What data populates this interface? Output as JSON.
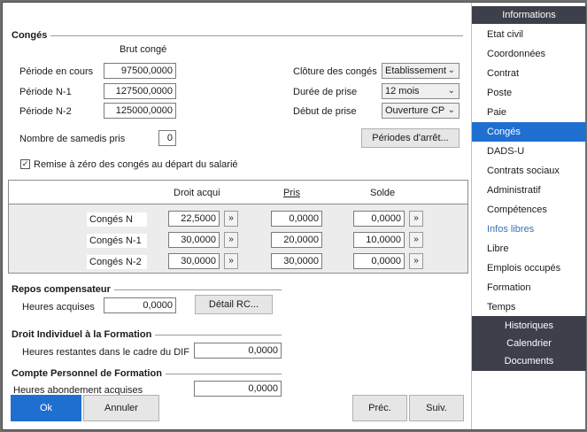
{
  "conges": {
    "title": "Congés",
    "brut_header": "Brut congé",
    "periode_en_cours_label": "Période en cours",
    "periode_en_cours_value": "97500,0000",
    "periode_n1_label": "Période N-1",
    "periode_n1_value": "127500,0000",
    "periode_n2_label": "Période N-2",
    "periode_n2_value": "125000,0000",
    "cloture_label": "Clôture des congés",
    "cloture_value": "Etablissement",
    "duree_label": "Durée de prise",
    "duree_value": "12 mois",
    "debut_label": "Début de prise",
    "debut_value": "Ouverture CP",
    "samedis_label": "Nombre de samedis pris",
    "samedis_value": "0",
    "periodes_arret_button": "Périodes d'arrêt...",
    "remise_checkbox_label": "Remise à zéro des congés au départ du salarié",
    "remise_checked": true
  },
  "grid": {
    "headers": {
      "droit_acquis": "Droit acqui",
      "pris": "Pris",
      "solde": "Solde"
    },
    "arrow": "»",
    "rows": [
      {
        "label": "Congés N",
        "droit": "22,5000",
        "pris": "0,0000",
        "solde": "0,0000"
      },
      {
        "label": "Congés N-1",
        "droit": "30,0000",
        "pris": "20,0000",
        "solde": "10,0000"
      },
      {
        "label": "Congés N-2",
        "droit": "30,0000",
        "pris": "30,0000",
        "solde": "0,0000"
      }
    ]
  },
  "repos": {
    "title": "Repos compensateur",
    "heures_label": "Heures acquises",
    "heures_value": "0,0000",
    "detail_button": "Détail RC..."
  },
  "dif": {
    "title": "Droit Individuel à la Formation",
    "heures_label": "Heures restantes dans le cadre du DIF",
    "heures_value": "0,0000"
  },
  "cpf": {
    "title": "Compte Personnel de Formation",
    "heures_label": "Heures abondement acquises",
    "heures_value": "0,0000"
  },
  "footer": {
    "ok": "Ok",
    "annuler": "Annuler",
    "prec": "Préc.",
    "suiv": "Suiv."
  },
  "sidebar": {
    "header": "Informations",
    "items": [
      {
        "label": "Etat civil"
      },
      {
        "label": "Coordonnées"
      },
      {
        "label": "Contrat"
      },
      {
        "label": "Poste"
      },
      {
        "label": "Paie"
      },
      {
        "label": "Congés"
      },
      {
        "label": "DADS-U"
      },
      {
        "label": "Contrats sociaux"
      },
      {
        "label": "Administratif"
      },
      {
        "label": "Compétences"
      },
      {
        "label": "Infos libres"
      },
      {
        "label": "Libre"
      },
      {
        "label": "Emplois occupés"
      },
      {
        "label": "Formation"
      },
      {
        "label": "Temps"
      }
    ],
    "active_item": "Congés",
    "sub_items": [
      {
        "label": "Historiques"
      },
      {
        "label": "Calendrier"
      },
      {
        "label": "Documents"
      }
    ]
  },
  "colors": {
    "accent": "#1f6fd1",
    "sidebar_dark": "#3d3f4a"
  }
}
